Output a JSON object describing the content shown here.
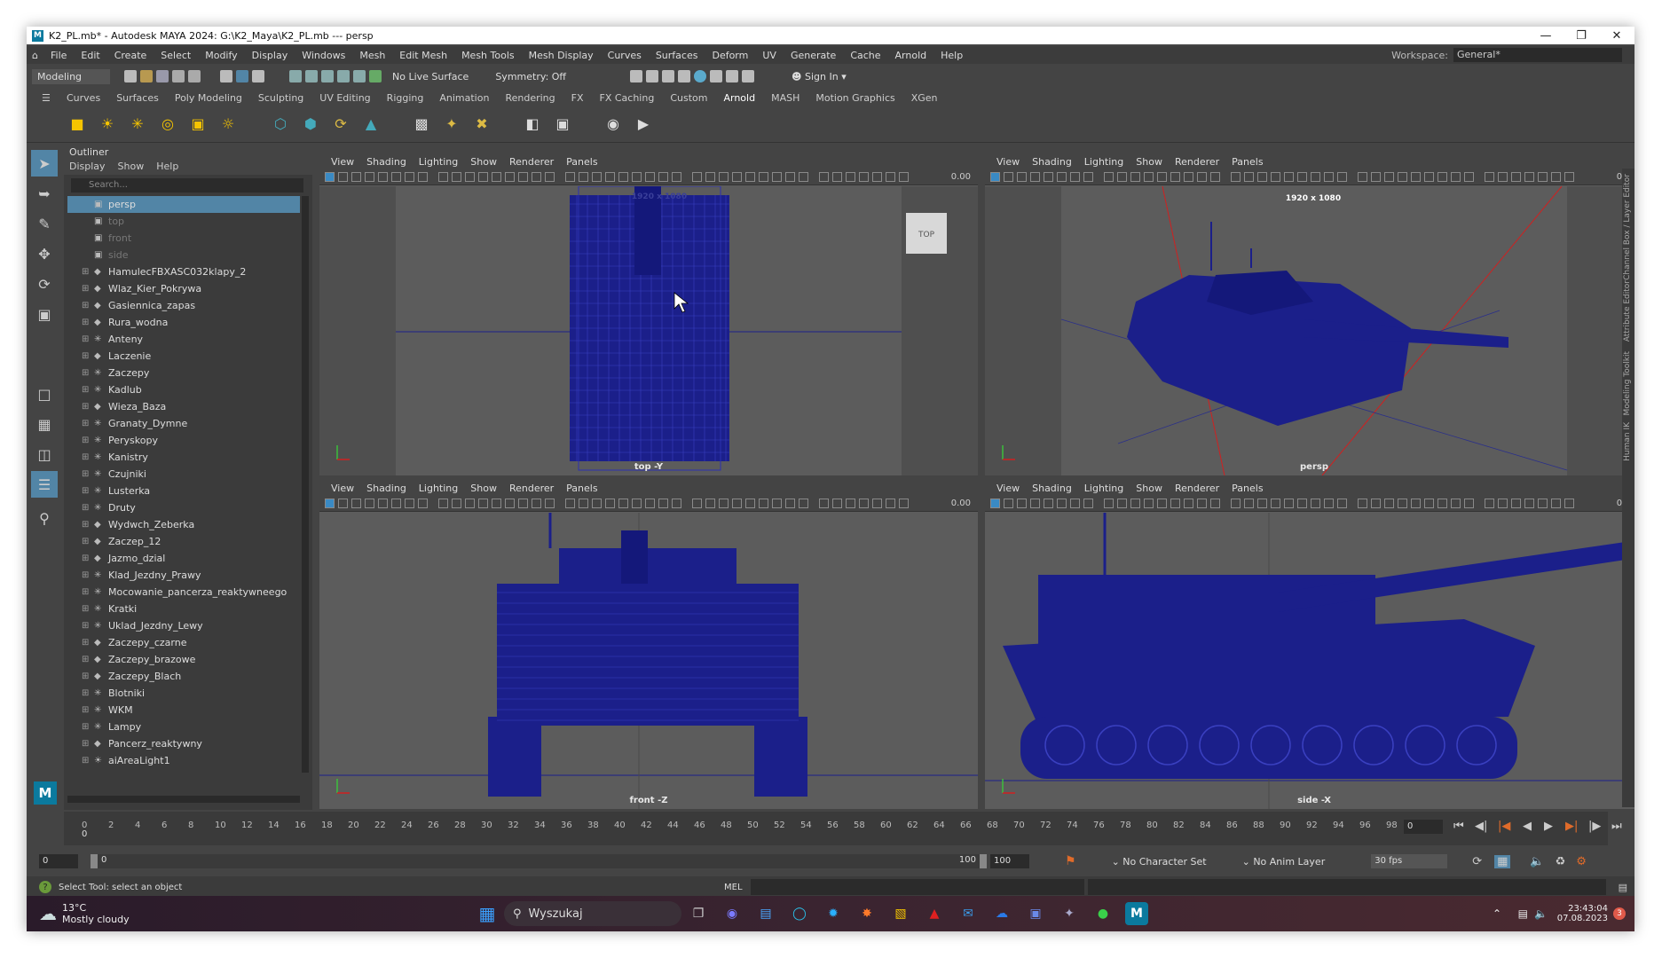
{
  "window": {
    "title": "K2_PL.mb* - Autodesk MAYA 2024: G:\\K2_Maya\\K2_PL.mb  ---  persp",
    "app_badge": "M"
  },
  "menu": [
    "File",
    "Edit",
    "Create",
    "Select",
    "Modify",
    "Display",
    "Windows",
    "Mesh",
    "Edit Mesh",
    "Mesh Tools",
    "Mesh Display",
    "Curves",
    "Surfaces",
    "Deform",
    "UV",
    "Generate",
    "Cache",
    "Arnold",
    "Help"
  ],
  "workspace": {
    "label": "Workspace:",
    "value": "General*"
  },
  "statusline": {
    "mode": "Modeling",
    "live_surface": "No Live Surface",
    "symmetry": "Symmetry: Off",
    "sign_in": "Sign In"
  },
  "shelf_tabs": [
    "Curves",
    "Surfaces",
    "Poly Modeling",
    "Sculpting",
    "UV Editing",
    "Rigging",
    "Animation",
    "Rendering",
    "FX",
    "FX Caching",
    "Custom",
    "Arnold",
    "MASH",
    "Motion Graphics",
    "XGen"
  ],
  "shelf_active": "Arnold",
  "outliner": {
    "title": "Outliner",
    "menu": [
      "Display",
      "Show",
      "Help"
    ],
    "search_placeholder": "Search...",
    "items": [
      {
        "name": "persp",
        "type": "camera",
        "selected": true
      },
      {
        "name": "top",
        "type": "camera"
      },
      {
        "name": "front",
        "type": "camera"
      },
      {
        "name": "side",
        "type": "camera"
      },
      {
        "name": "HamulecFBXASC032klapy_2",
        "type": "transform"
      },
      {
        "name": "Wlaz_Kier_Pokrywa",
        "type": "transform"
      },
      {
        "name": "Gasiennica_zapas",
        "type": "transform"
      },
      {
        "name": "Rura_wodna",
        "type": "transform"
      },
      {
        "name": "Anteny",
        "type": "group"
      },
      {
        "name": "Laczenie",
        "type": "transform"
      },
      {
        "name": "Zaczepy",
        "type": "group"
      },
      {
        "name": "Kadlub",
        "type": "group"
      },
      {
        "name": "Wieza_Baza",
        "type": "transform"
      },
      {
        "name": "Granaty_Dymne",
        "type": "group"
      },
      {
        "name": "Peryskopy",
        "type": "group"
      },
      {
        "name": "Kanistry",
        "type": "group"
      },
      {
        "name": "Czujniki",
        "type": "group"
      },
      {
        "name": "Lusterka",
        "type": "group"
      },
      {
        "name": "Druty",
        "type": "group"
      },
      {
        "name": "Wydwch_Zeberka",
        "type": "transform"
      },
      {
        "name": "Zaczep_12",
        "type": "transform"
      },
      {
        "name": "Jazmo_dzial",
        "type": "transform"
      },
      {
        "name": "Klad_Jezdny_Prawy",
        "type": "group"
      },
      {
        "name": "Mocowanie_pancerza_reaktywneego",
        "type": "group"
      },
      {
        "name": "Kratki",
        "type": "group"
      },
      {
        "name": "Uklad_Jezdny_Lewy",
        "type": "group"
      },
      {
        "name": "Zaczepy_czarne",
        "type": "transform"
      },
      {
        "name": "Zaczepy_brazowe",
        "type": "transform"
      },
      {
        "name": "Zaczepy_Blach",
        "type": "transform"
      },
      {
        "name": "Blotniki",
        "type": "group"
      },
      {
        "name": "WKM",
        "type": "group"
      },
      {
        "name": "Lampy",
        "type": "group"
      },
      {
        "name": "Pancerz_reaktywny",
        "type": "transform"
      },
      {
        "name": "aiAreaLight1",
        "type": "light"
      }
    ]
  },
  "viewport_menu": [
    "View",
    "Shading",
    "Lighting",
    "Show",
    "Renderer",
    "Panels"
  ],
  "viewport_value": "0.00",
  "viewports": [
    {
      "label": "top -Y",
      "resolution": "1920 x 1080",
      "cube": "TOP"
    },
    {
      "label": "persp",
      "resolution": "1920 x 1080"
    },
    {
      "label": "front -Z"
    },
    {
      "label": "side -X"
    }
  ],
  "timeline": {
    "ticks": [
      0,
      2,
      4,
      6,
      8,
      10,
      12,
      14,
      16,
      18,
      20,
      22,
      24,
      26,
      28,
      30,
      32,
      34,
      36,
      38,
      40,
      42,
      44,
      46,
      48,
      50,
      52,
      54,
      56,
      58,
      60,
      62,
      64,
      66,
      68,
      70,
      72,
      74,
      76,
      78,
      80,
      82,
      84,
      86,
      88,
      90,
      92,
      94,
      96,
      98,
      100
    ],
    "current_frame": "0",
    "current_marker": "0"
  },
  "range": {
    "start": "0",
    "inner_start": "0",
    "inner_end": "100",
    "end": "100",
    "character_set": "No Character Set",
    "anim_layer": "No Anim Layer",
    "fps": "30 fps"
  },
  "cmdline": {
    "help": "Select Tool: select an object",
    "lang": "MEL"
  },
  "side_tabs": [
    "Channel Box / Layer Editor",
    "Attribute Editor",
    "Modeling Toolkit",
    "Human IK"
  ],
  "taskbar": {
    "temp": "13°C",
    "weather": "Mostly cloudy",
    "search": "Wyszukaj",
    "time": "23:43:04",
    "date": "07.08.2023",
    "notif": "3"
  },
  "colors": {
    "selected": "#5285a6",
    "mesh": "#1b1f8a",
    "accent": "#0b7a9e"
  }
}
